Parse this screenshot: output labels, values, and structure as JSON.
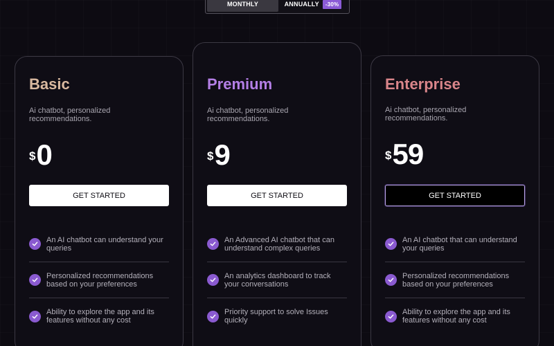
{
  "billing_toggle": {
    "monthly_label": "MONTHLY",
    "annually_label": "ANNUALLY",
    "discount_label": "-30%",
    "selected": "MONTHLY"
  },
  "plans": [
    {
      "name": "Basic",
      "title_color": "#d9b9a0",
      "description": "Ai chatbot, personalized recommendations.",
      "currency": "$",
      "price": "0",
      "cta_label": "GET STARTED",
      "features": [
        "An AI chatbot can understand your queries",
        "Personalized recommendations based on your preferences",
        "Ability to explore the app and its features without any cost"
      ]
    },
    {
      "name": "Premium",
      "title_color": "#b47fe6",
      "description": "Ai chatbot, personalized recommendations.",
      "currency": "$",
      "price": "9",
      "cta_label": "GET STARTED",
      "features": [
        "An Advanced AI chatbot that can understand complex queries",
        "An analytics dashboard to track your conversations",
        "Priority support to solve Issues quickly"
      ]
    },
    {
      "name": "Enterprise",
      "title_color": "#d9858a",
      "description": "Ai chatbot, personalized recommendations.",
      "currency": "$",
      "price": "59",
      "cta_label": "GET STARTED",
      "features": [
        "An AI chatbot that can understand your queries",
        "Personalized recommendations based on your preferences",
        "Ability to explore the app and its features without any cost"
      ]
    }
  ],
  "colors": {
    "background": "#0d0b12",
    "check_badge": "#8a5ad0",
    "discount_badge": "#8b5bd6"
  },
  "icons": {
    "feature_icon": "check-circle-icon"
  }
}
